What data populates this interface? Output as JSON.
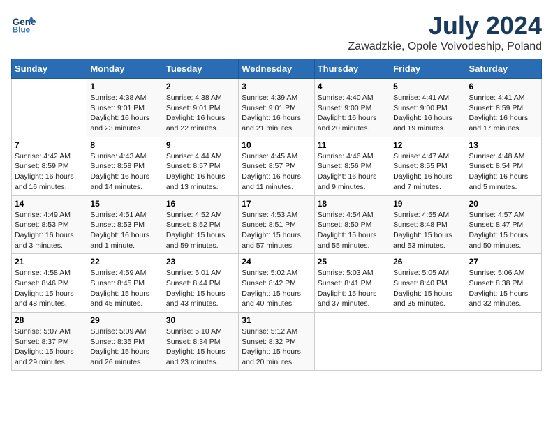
{
  "logo": {
    "line1": "General",
    "line2": "Blue"
  },
  "title": "July 2024",
  "subtitle": "Zawadzkie, Opole Voivodeship, Poland",
  "days_of_week": [
    "Sunday",
    "Monday",
    "Tuesday",
    "Wednesday",
    "Thursday",
    "Friday",
    "Saturday"
  ],
  "weeks": [
    [
      {
        "num": "",
        "info": ""
      },
      {
        "num": "1",
        "info": "Sunrise: 4:38 AM\nSunset: 9:01 PM\nDaylight: 16 hours and 23 minutes."
      },
      {
        "num": "2",
        "info": "Sunrise: 4:38 AM\nSunset: 9:01 PM\nDaylight: 16 hours and 22 minutes."
      },
      {
        "num": "3",
        "info": "Sunrise: 4:39 AM\nSunset: 9:01 PM\nDaylight: 16 hours and 21 minutes."
      },
      {
        "num": "4",
        "info": "Sunrise: 4:40 AM\nSunset: 9:00 PM\nDaylight: 16 hours and 20 minutes."
      },
      {
        "num": "5",
        "info": "Sunrise: 4:41 AM\nSunset: 9:00 PM\nDaylight: 16 hours and 19 minutes."
      },
      {
        "num": "6",
        "info": "Sunrise: 4:41 AM\nSunset: 8:59 PM\nDaylight: 16 hours and 17 minutes."
      }
    ],
    [
      {
        "num": "7",
        "info": "Sunrise: 4:42 AM\nSunset: 8:59 PM\nDaylight: 16 hours and 16 minutes."
      },
      {
        "num": "8",
        "info": "Sunrise: 4:43 AM\nSunset: 8:58 PM\nDaylight: 16 hours and 14 minutes."
      },
      {
        "num": "9",
        "info": "Sunrise: 4:44 AM\nSunset: 8:57 PM\nDaylight: 16 hours and 13 minutes."
      },
      {
        "num": "10",
        "info": "Sunrise: 4:45 AM\nSunset: 8:57 PM\nDaylight: 16 hours and 11 minutes."
      },
      {
        "num": "11",
        "info": "Sunrise: 4:46 AM\nSunset: 8:56 PM\nDaylight: 16 hours and 9 minutes."
      },
      {
        "num": "12",
        "info": "Sunrise: 4:47 AM\nSunset: 8:55 PM\nDaylight: 16 hours and 7 minutes."
      },
      {
        "num": "13",
        "info": "Sunrise: 4:48 AM\nSunset: 8:54 PM\nDaylight: 16 hours and 5 minutes."
      }
    ],
    [
      {
        "num": "14",
        "info": "Sunrise: 4:49 AM\nSunset: 8:53 PM\nDaylight: 16 hours and 3 minutes."
      },
      {
        "num": "15",
        "info": "Sunrise: 4:51 AM\nSunset: 8:53 PM\nDaylight: 16 hours and 1 minute."
      },
      {
        "num": "16",
        "info": "Sunrise: 4:52 AM\nSunset: 8:52 PM\nDaylight: 15 hours and 59 minutes."
      },
      {
        "num": "17",
        "info": "Sunrise: 4:53 AM\nSunset: 8:51 PM\nDaylight: 15 hours and 57 minutes."
      },
      {
        "num": "18",
        "info": "Sunrise: 4:54 AM\nSunset: 8:50 PM\nDaylight: 15 hours and 55 minutes."
      },
      {
        "num": "19",
        "info": "Sunrise: 4:55 AM\nSunset: 8:48 PM\nDaylight: 15 hours and 53 minutes."
      },
      {
        "num": "20",
        "info": "Sunrise: 4:57 AM\nSunset: 8:47 PM\nDaylight: 15 hours and 50 minutes."
      }
    ],
    [
      {
        "num": "21",
        "info": "Sunrise: 4:58 AM\nSunset: 8:46 PM\nDaylight: 15 hours and 48 minutes."
      },
      {
        "num": "22",
        "info": "Sunrise: 4:59 AM\nSunset: 8:45 PM\nDaylight: 15 hours and 45 minutes."
      },
      {
        "num": "23",
        "info": "Sunrise: 5:01 AM\nSunset: 8:44 PM\nDaylight: 15 hours and 43 minutes."
      },
      {
        "num": "24",
        "info": "Sunrise: 5:02 AM\nSunset: 8:42 PM\nDaylight: 15 hours and 40 minutes."
      },
      {
        "num": "25",
        "info": "Sunrise: 5:03 AM\nSunset: 8:41 PM\nDaylight: 15 hours and 37 minutes."
      },
      {
        "num": "26",
        "info": "Sunrise: 5:05 AM\nSunset: 8:40 PM\nDaylight: 15 hours and 35 minutes."
      },
      {
        "num": "27",
        "info": "Sunrise: 5:06 AM\nSunset: 8:38 PM\nDaylight: 15 hours and 32 minutes."
      }
    ],
    [
      {
        "num": "28",
        "info": "Sunrise: 5:07 AM\nSunset: 8:37 PM\nDaylight: 15 hours and 29 minutes."
      },
      {
        "num": "29",
        "info": "Sunrise: 5:09 AM\nSunset: 8:35 PM\nDaylight: 15 hours and 26 minutes."
      },
      {
        "num": "30",
        "info": "Sunrise: 5:10 AM\nSunset: 8:34 PM\nDaylight: 15 hours and 23 minutes."
      },
      {
        "num": "31",
        "info": "Sunrise: 5:12 AM\nSunset: 8:32 PM\nDaylight: 15 hours and 20 minutes."
      },
      {
        "num": "",
        "info": ""
      },
      {
        "num": "",
        "info": ""
      },
      {
        "num": "",
        "info": ""
      }
    ]
  ]
}
